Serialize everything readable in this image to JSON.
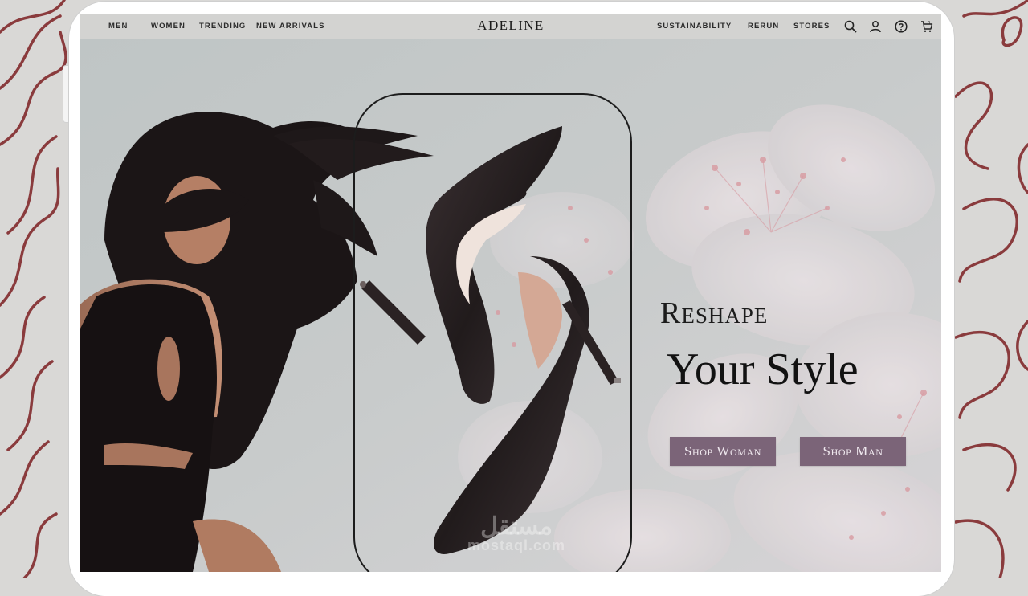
{
  "nav": {
    "left_links": [
      "MEN",
      "WOMEN",
      "TRENDING",
      "NEW ARRIVALS"
    ],
    "brand": "ADELINE",
    "right_links": [
      "SUSTAINABILITY",
      "RERUN",
      "STORES"
    ],
    "icons": [
      "search-icon",
      "user-icon",
      "help-icon",
      "cart-icon"
    ]
  },
  "hero": {
    "heading_line1": "Reshape",
    "heading_line2": "Your Style",
    "cta_women": "Shop Woman",
    "cta_men": "Shop Man"
  },
  "watermark": {
    "main": "مستقل",
    "sub": "mostaql.com"
  },
  "colors": {
    "accent": "#7b6478",
    "squiggle": "#8a3b3d",
    "nav_bg": "#d3d3d1",
    "hero_bg": "#c3c7c7"
  }
}
